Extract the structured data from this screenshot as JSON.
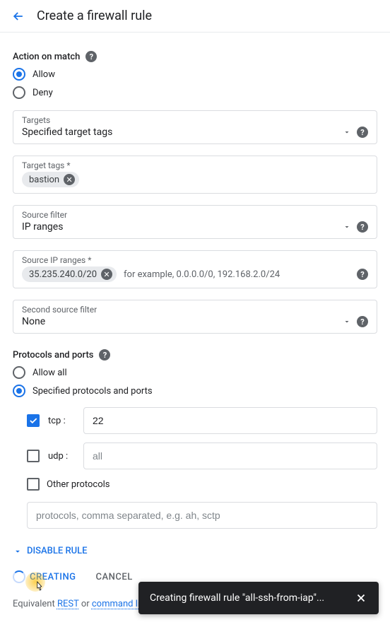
{
  "header": {
    "title": "Create a firewall rule"
  },
  "action_on_match": {
    "label": "Action on match",
    "options": {
      "allow": "Allow",
      "deny": "Deny"
    },
    "selected": "allow"
  },
  "targets": {
    "label": "Targets",
    "value": "Specified target tags"
  },
  "target_tags": {
    "label": "Target tags *",
    "chips": [
      "bastion"
    ]
  },
  "source_filter": {
    "label": "Source filter",
    "value": "IP ranges"
  },
  "source_ip_ranges": {
    "label": "Source IP ranges *",
    "chips": [
      "35.235.240.0/20"
    ],
    "hint": "for example, 0.0.0.0/0, 192.168.2.0/24"
  },
  "second_source_filter": {
    "label": "Second source filter",
    "value": "None"
  },
  "protocols_ports": {
    "label": "Protocols and ports",
    "options": {
      "allow_all": "Allow all",
      "specified": "Specified protocols and ports"
    },
    "selected": "specified",
    "tcp": {
      "label": "tcp :",
      "checked": true,
      "value": "22"
    },
    "udp": {
      "label": "udp :",
      "checked": false,
      "placeholder": "all"
    },
    "other": {
      "label": "Other protocols",
      "checked": false,
      "placeholder": "protocols, comma separated, e.g. ah, sctp"
    }
  },
  "disable_rule": {
    "label": "DISABLE RULE"
  },
  "buttons": {
    "create": "CREATING",
    "cancel": "CANCEL"
  },
  "footer": {
    "prefix": "Equivalent ",
    "rest": "REST",
    "middle": " or ",
    "cmdline": "command line"
  },
  "toast": {
    "message": "Creating firewall rule \"all-ssh-from-iap\"..."
  }
}
